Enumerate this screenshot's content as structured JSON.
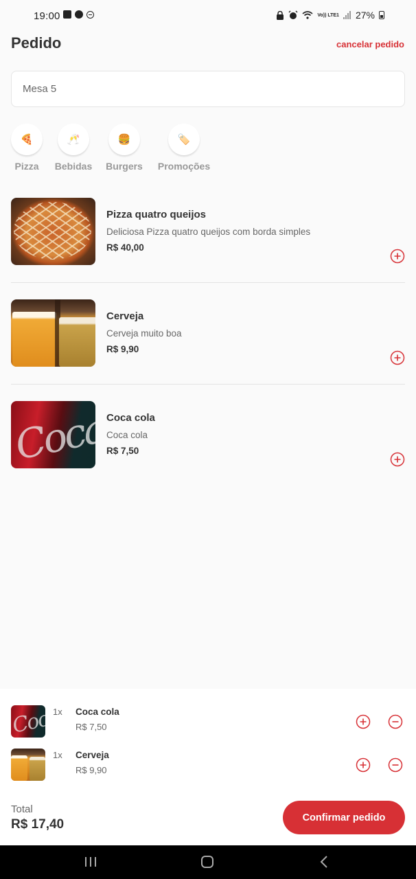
{
  "status_bar": {
    "time": "19:00",
    "network": "Vo)) LTE1",
    "battery": "27%"
  },
  "header": {
    "title": "Pedido",
    "cancel_label": "cancelar pedido"
  },
  "table_input": {
    "value": "Mesa 5"
  },
  "categories": [
    {
      "icon": "pizza-icon",
      "emoji": "🍕",
      "label": "Pizza"
    },
    {
      "icon": "drinks-icon",
      "emoji": "🥂",
      "label": "Bebidas"
    },
    {
      "icon": "burger-icon",
      "emoji": "🍔",
      "label": "Burgers"
    },
    {
      "icon": "tag-icon",
      "emoji": "🏷️",
      "label": "Promoções"
    }
  ],
  "products": [
    {
      "name": "Pizza quatro queijos",
      "description": "Deliciosa Pizza quatro queijos com borda simples",
      "price": "R$ 40,00"
    },
    {
      "name": "Cerveja",
      "description": "Cerveja muito boa",
      "price": "R$ 9,90"
    },
    {
      "name": "Coca cola",
      "description": "Coca cola",
      "price": "R$ 7,50"
    }
  ],
  "order": {
    "items": [
      {
        "qty": "1x",
        "name": "Coca cola",
        "price": "R$ 7,50"
      },
      {
        "qty": "1x",
        "name": "Cerveja",
        "price": "R$ 9,90"
      }
    ],
    "total_label": "Total",
    "total_value": "R$ 17,40",
    "confirm_label": "Confirmar pedido"
  },
  "colors": {
    "accent": "#d73035",
    "background": "#fafafa",
    "text": "#333333",
    "muted": "#666666"
  }
}
